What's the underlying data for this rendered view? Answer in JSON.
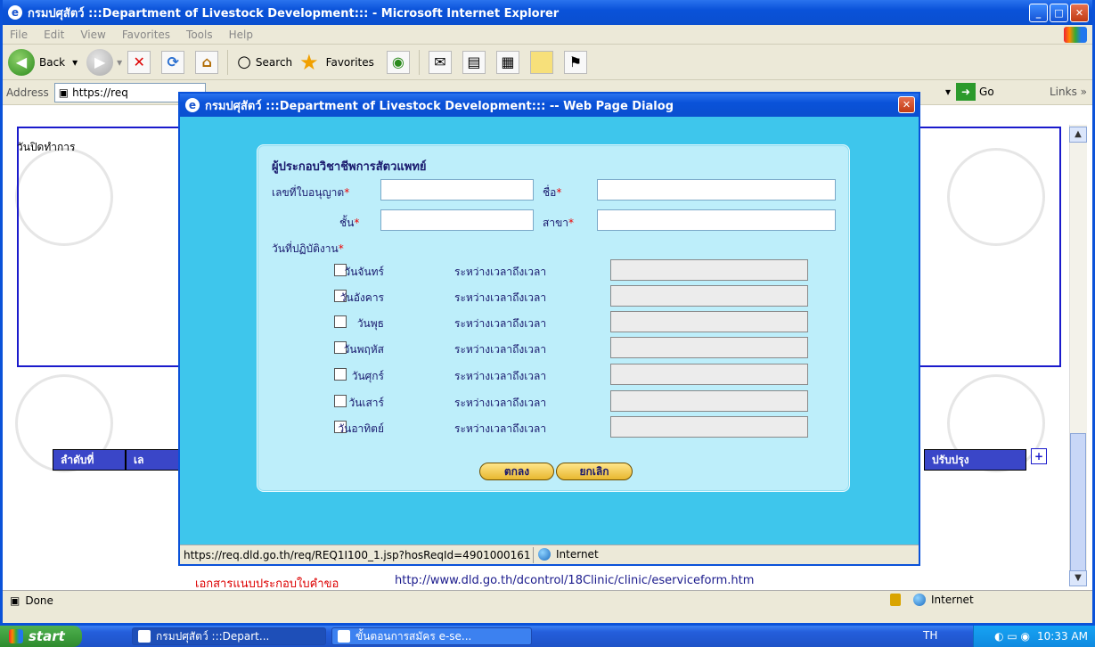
{
  "ie": {
    "title": "กรมปศุสัตว์ :::Department of Livestock Development::: - Microsoft Internet Explorer",
    "menu": [
      "File",
      "Edit",
      "View",
      "Favorites",
      "Tools",
      "Help"
    ],
    "toolbar": {
      "back": "Back",
      "search": "Search",
      "favorites": "Favorites"
    },
    "address": {
      "label": "Address",
      "value": "https://req",
      "go": "Go",
      "links": "Links"
    },
    "status_done": "Done",
    "status_zone": "Internet"
  },
  "page": {
    "panel_label": "วันปิดทำการ",
    "table_headers": [
      "ลำดับที่",
      "เล",
      "ปรับปรุง"
    ],
    "doc_label": "เอกสารแนบประกอบใบคำขอ",
    "doc_url": "http://www.dld.go.th/dcontrol/18Clinic/clinic/eserviceform.htm"
  },
  "dialog": {
    "title": "กรมปศุสัตว์ :::Department of Livestock Development::: -- Web Page Dialog",
    "form_title": "ผู้ประกอบวิชาชีพการสัตวแพทย์",
    "fields": {
      "license_label": "เลขที่ใบอนุญาต",
      "name_label": "ชื่อ",
      "class_label": "ชั้น",
      "branch_label": "สาขา",
      "workdays_label": "วันที่ปฏิบัติงาน",
      "required_mark": "*"
    },
    "days": [
      {
        "name": "วันจันทร์",
        "time_label": "ระหว่างเวลาถึงเวลา"
      },
      {
        "name": "วันอังคาร",
        "time_label": "ระหว่างเวลาถึงเวลา"
      },
      {
        "name": "วันพุธ",
        "time_label": "ระหว่างเวลาถึงเวลา"
      },
      {
        "name": "วันพฤหัส",
        "time_label": "ระหว่างเวลาถึงเวลา"
      },
      {
        "name": "วันศุกร์",
        "time_label": "ระหว่างเวลาถึงเวลา"
      },
      {
        "name": "วันเสาร์",
        "time_label": "ระหว่างเวลาถึงเวลา"
      },
      {
        "name": "วันอาทิตย์",
        "time_label": "ระหว่างเวลาถึงเวลา"
      }
    ],
    "buttons": {
      "ok": "ตกลง",
      "cancel": "ยกเลิก"
    },
    "status_url": "https://req.dld.go.th/req/REQ1I100_1.jsp?hosReqId=4901000161",
    "status_zone": "Internet"
  },
  "taskbar": {
    "start": "start",
    "tasks": [
      "กรมปศุสัตว์ :::Depart...",
      "ขั้นตอนการสมัคร e-se..."
    ],
    "lang": "TH",
    "clock": "10:33 AM"
  }
}
